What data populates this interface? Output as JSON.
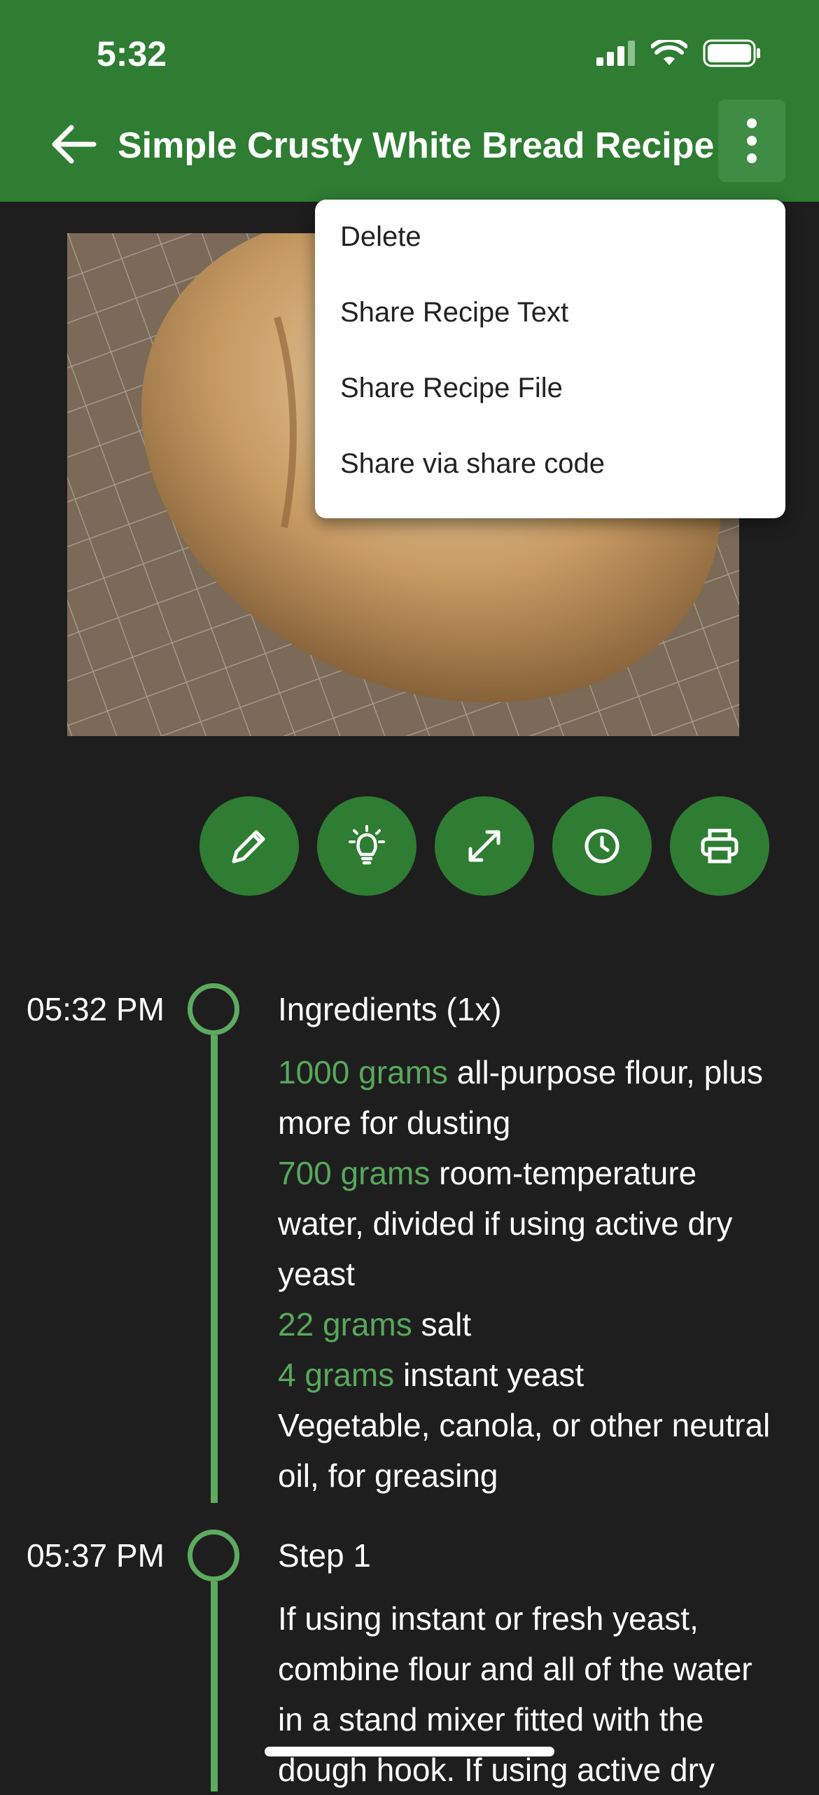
{
  "status": {
    "time": "5:32"
  },
  "header": {
    "title": "Simple Crusty White Bread Recipe"
  },
  "menu": {
    "items": [
      "Delete",
      "Share Recipe Text",
      "Share Recipe File",
      "Share via share code"
    ]
  },
  "actions": [
    "edit-icon",
    "lightbulb-icon",
    "expand-icon",
    "clock-icon",
    "print-icon"
  ],
  "timeline": {
    "ingredients": {
      "time": "05:32 PM",
      "heading": "Ingredients (1x)",
      "lines": [
        {
          "qty": "1000 grams",
          "text": " all-purpose flour, plus more for dusting"
        },
        {
          "qty": "700 grams",
          "text": " room-temperature water, divided if using active dry yeast"
        },
        {
          "qty": "22 grams",
          "text": " salt"
        },
        {
          "qty": "4 grams",
          "text": " instant yeast"
        },
        {
          "qty": "",
          "text": "Vegetable, canola, or other neutral oil, for greasing"
        }
      ]
    },
    "step1": {
      "time": "05:37 PM",
      "heading": "Step 1",
      "text": "If using instant or fresh yeast, combine flour and all of the water in a stand mixer fitted with the dough hook. If using active dry"
    }
  },
  "colors": {
    "primary": "#2e7d32",
    "accent": "#5cab5f",
    "background": "#1e1e1f"
  }
}
